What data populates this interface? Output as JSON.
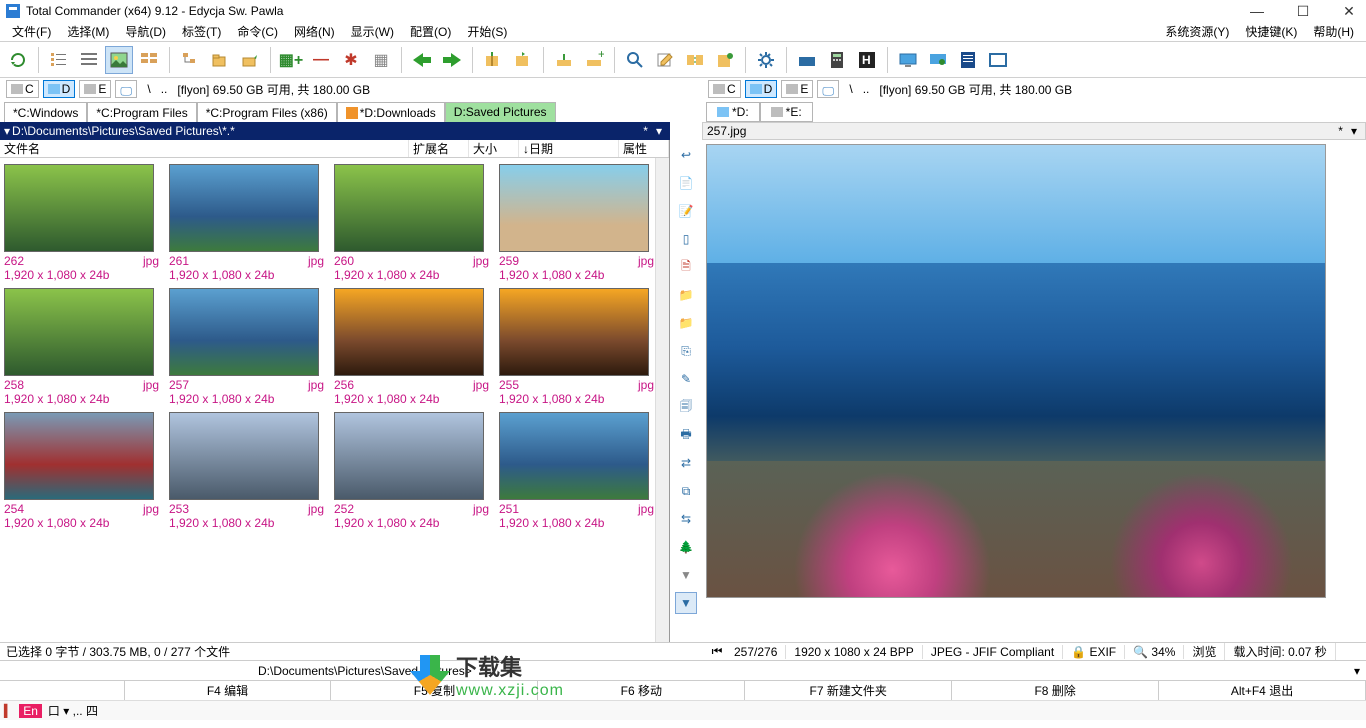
{
  "window": {
    "title": "Total Commander (x64) 9.12 - Edycja Sw. Pawla"
  },
  "menu": [
    "文件(F)",
    "选择(M)",
    "导航(D)",
    "标签(T)",
    "命令(C)",
    "网络(N)",
    "显示(W)",
    "配置(O)",
    "开始(S)"
  ],
  "menu_right": [
    "系统资源(Y)",
    "快捷键(K)",
    "帮助(H)"
  ],
  "drives": {
    "left": {
      "letters": [
        "C",
        "D",
        "E"
      ],
      "selected": "D",
      "root_sep": "\\",
      "dots": "..",
      "info": "[flyon]  69.50 GB 可用, 共 180.00 GB"
    },
    "right": {
      "letters": [
        "C",
        "D",
        "E"
      ],
      "selected": "D",
      "root_sep": "\\",
      "dots": "..",
      "info": "[flyon]  69.50 GB 可用, 共 180.00 GB"
    }
  },
  "tabs_left": [
    {
      "label": "*C:Windows",
      "locked": true
    },
    {
      "label": "*C:Program Files",
      "locked": true
    },
    {
      "label": "*C:Program Files (x86)",
      "locked": true
    },
    {
      "label": "*D:Downloads",
      "locked": true,
      "orange": true
    },
    {
      "label": "D:Saved Pictures",
      "active": true
    }
  ],
  "tabs_right": [
    {
      "label": "*D:",
      "locked": true,
      "hd": true
    },
    {
      "label": "*E:",
      "locked": true,
      "hd": true
    }
  ],
  "path_left": "D:\\Documents\\Pictures\\Saved Pictures\\*.*",
  "path_right": "257.jpg",
  "columns": {
    "name": "文件名",
    "ext": "扩展名",
    "size": "大小",
    "date": "↓日期",
    "attr": "属性"
  },
  "thumbs": [
    {
      "n": "262",
      "e": "jpg",
      "d": "1,920 x 1,080 x 24b",
      "c": "forest"
    },
    {
      "n": "261",
      "e": "jpg",
      "d": "1,920 x 1,080 x 24b",
      "c": "lake"
    },
    {
      "n": "260",
      "e": "jpg",
      "d": "1,920 x 1,080 x 24b",
      "c": "forest"
    },
    {
      "n": "259",
      "e": "jpg",
      "d": "1,920 x 1,080 x 24b",
      "c": "beach"
    },
    {
      "n": "258",
      "e": "jpg",
      "d": "1,920 x 1,080 x 24b",
      "c": "forest"
    },
    {
      "n": "257",
      "e": "jpg",
      "d": "1,920 x 1,080 x 24b",
      "c": "lake"
    },
    {
      "n": "256",
      "e": "jpg",
      "d": "1,920 x 1,080 x 24b",
      "c": "sunset"
    },
    {
      "n": "255",
      "e": "jpg",
      "d": "1,920 x 1,080 x 24b",
      "c": "sunset"
    },
    {
      "n": "254",
      "e": "jpg",
      "d": "1,920 x 1,080 x 24b",
      "c": "boats"
    },
    {
      "n": "253",
      "e": "jpg",
      "d": "1,920 x 1,080 x 24b",
      "c": "mountain"
    },
    {
      "n": "252",
      "e": "jpg",
      "d": "1,920 x 1,080 x 24b",
      "c": "mountain"
    },
    {
      "n": "251",
      "e": "jpg",
      "d": "1,920 x 1,080 x 24b",
      "c": "lake"
    }
  ],
  "left_status": "已选择 0 字节 / 303.75 MB, 0 / 277 个文件",
  "right_status": {
    "pos": "257/276",
    "dim": "1920 x 1080 x 24 BPP",
    "fmt": "JPEG - JFIF Compliant",
    "exif": "EXIF",
    "zoom": "34%",
    "browse": "浏览",
    "load": "载入时间:  0.07 秒"
  },
  "cmd_label": "D:\\Documents\\Pictures\\Saved Pictures>",
  "fkeys": [
    "F4 编辑",
    "F5 复制",
    "F6 移动",
    "F7 新建文件夹",
    "F8 删除",
    "Alt+F4 退出"
  ],
  "lang": "En",
  "lang_extra": "口 ▾ ,.. 四",
  "overlay": {
    "cn": "下载集",
    "en": "www.xzji.com"
  },
  "star": "*",
  "dropdown": "▾"
}
